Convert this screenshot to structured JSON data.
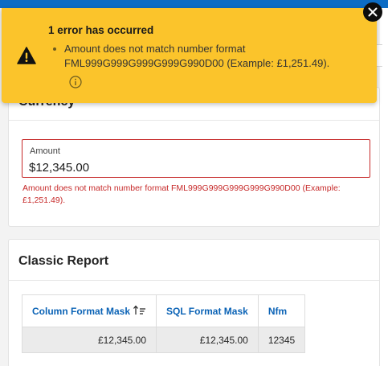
{
  "notification": {
    "title": "1 error has occurred",
    "message": "Amount does not match number format FML999G999G999G999G990D00 (Example: £1,251.49).",
    "icon": "warning-icon",
    "info_icon": "info-icon",
    "close_icon": "close-icon"
  },
  "currency_region": {
    "title": "Currency",
    "amount_label": "Amount",
    "amount_value": "$12,345.00",
    "amount_error": "Amount does not match number format FML999G999G999G999G990D00 (Example: £1,251.49)."
  },
  "report_region": {
    "title": "Classic Report",
    "columns": [
      "Column Format Mask",
      "SQL Format Mask",
      "Nfm"
    ],
    "rows": [
      [
        "£12,345.00",
        "£12,345.00",
        "12345"
      ]
    ]
  },
  "colors": {
    "error": "#c62828",
    "notification_bg": "#fbc42b",
    "link": "#0b63b6",
    "header_bar": "#0c6cc4"
  }
}
